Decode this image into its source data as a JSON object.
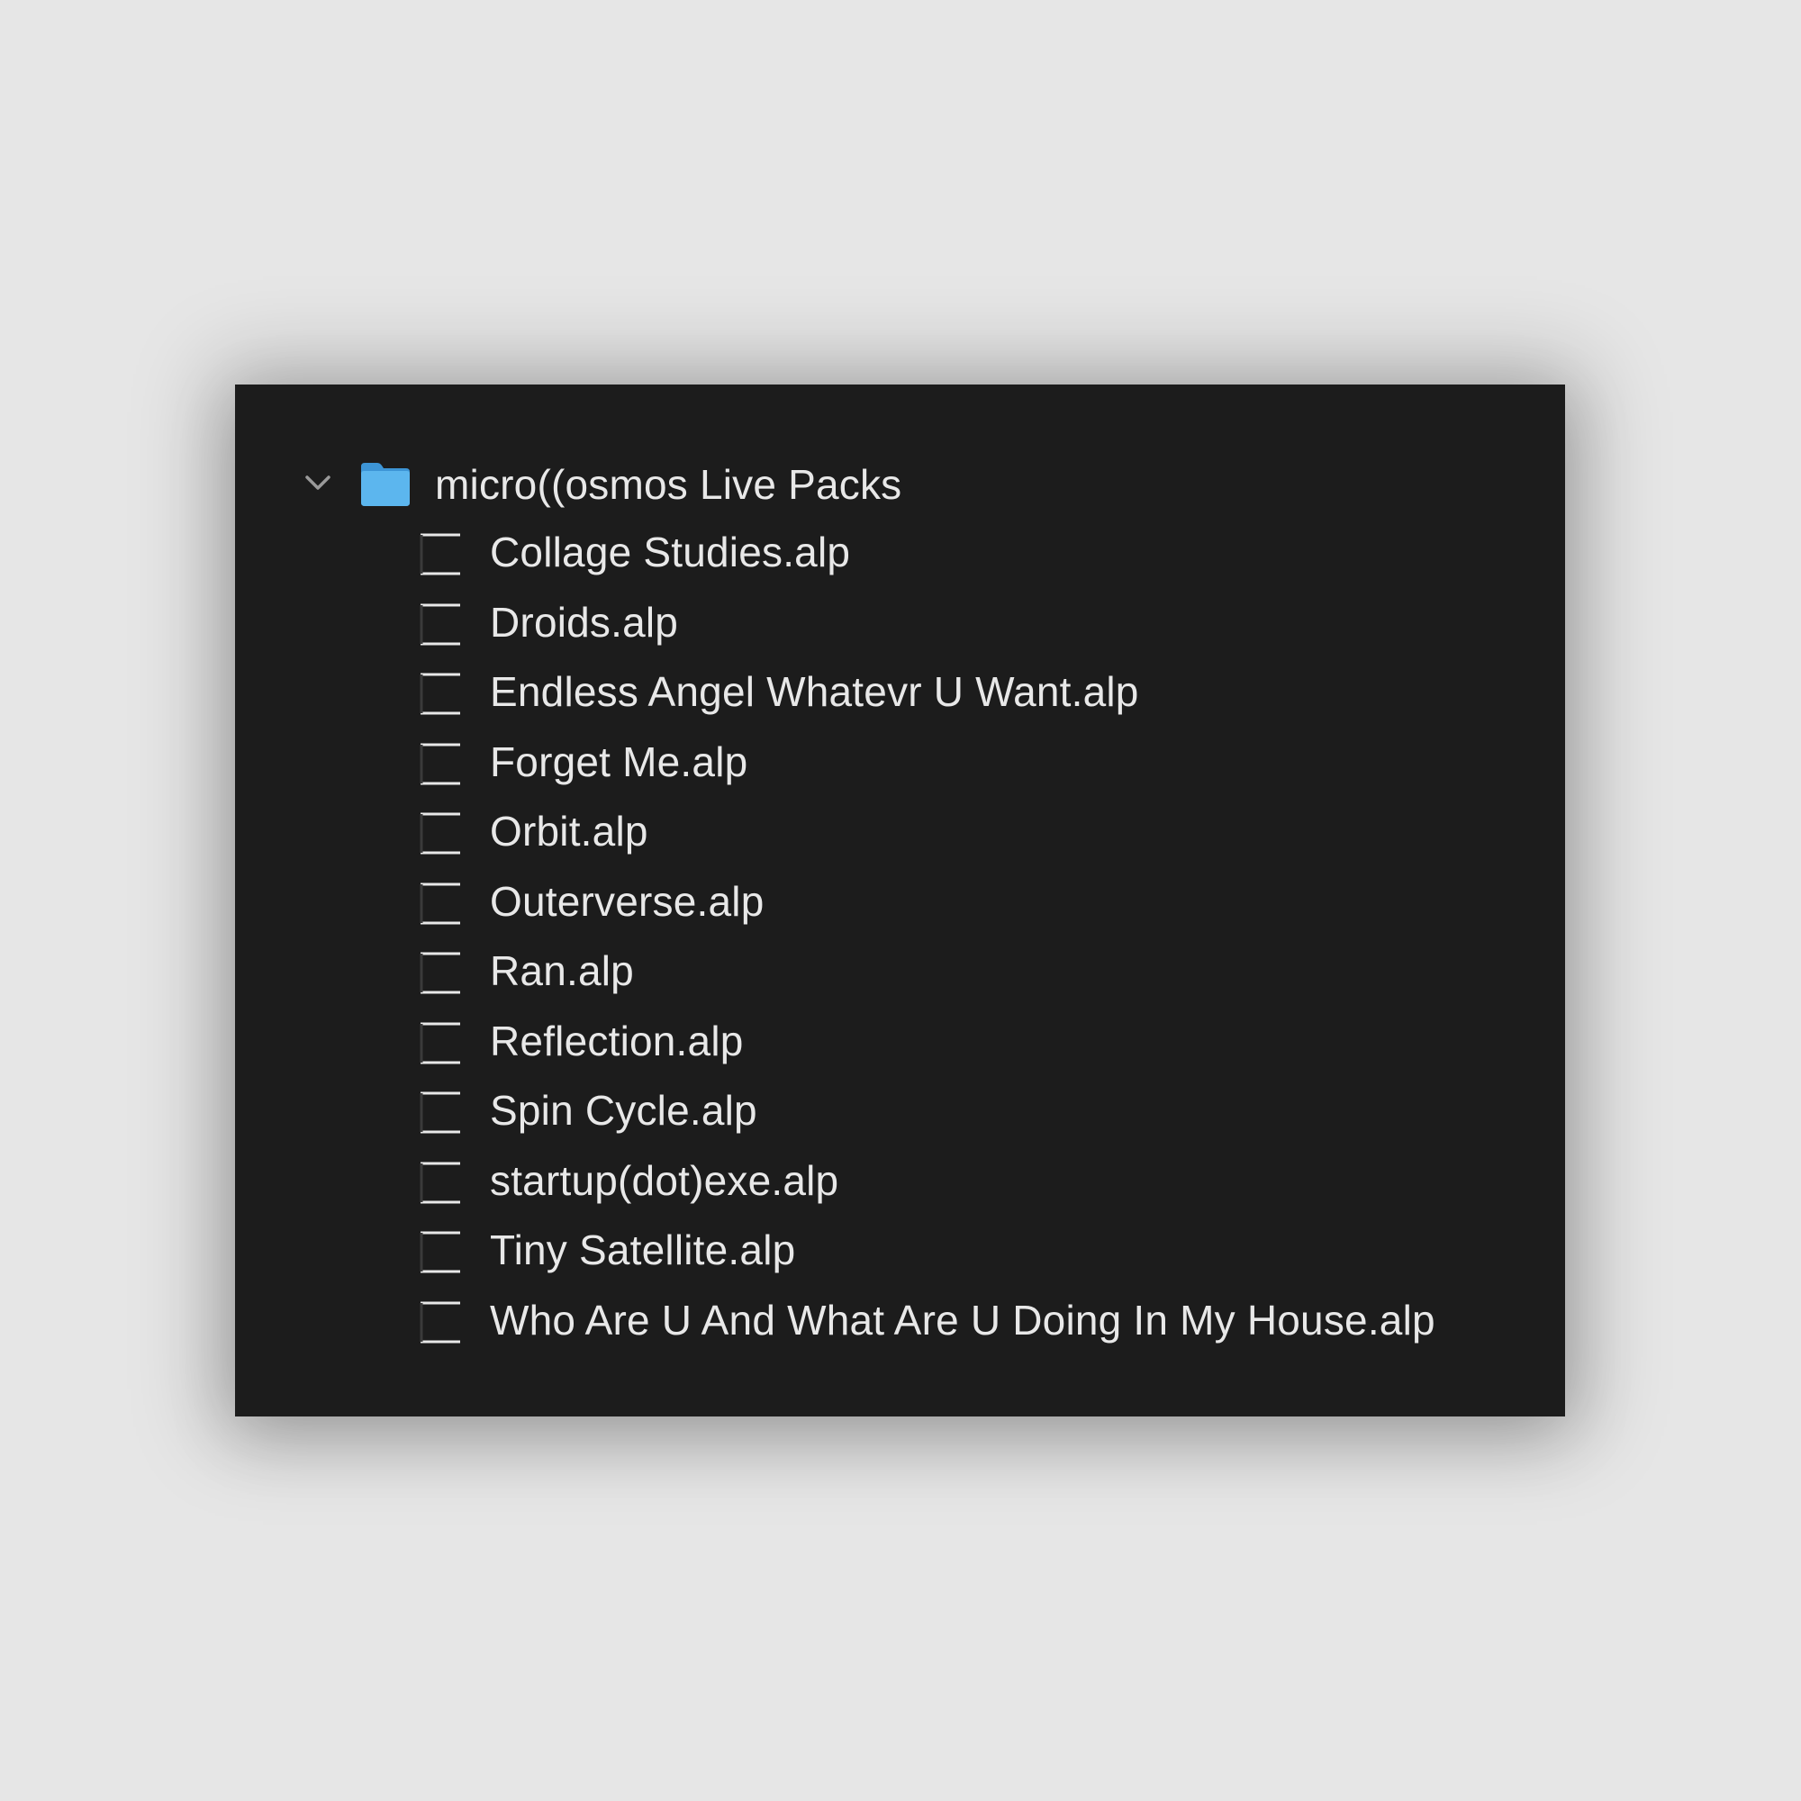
{
  "folder": {
    "name": "micro((osmos Live Packs",
    "expanded": true,
    "icon": "folder-icon",
    "icon_color": "#4aa8e6"
  },
  "files": [
    {
      "name": "Collage Studies.alp",
      "icon": "document-icon"
    },
    {
      "name": "Droids.alp",
      "icon": "document-icon"
    },
    {
      "name": "Endless Angel Whatevr U Want.alp",
      "icon": "document-icon"
    },
    {
      "name": "Forget Me.alp",
      "icon": "document-icon"
    },
    {
      "name": "Orbit.alp",
      "icon": "document-icon"
    },
    {
      "name": "Outerverse.alp",
      "icon": "document-icon"
    },
    {
      "name": "Ran.alp",
      "icon": "document-icon"
    },
    {
      "name": "Reflection.alp",
      "icon": "document-icon"
    },
    {
      "name": "Spin Cycle.alp",
      "icon": "document-icon"
    },
    {
      "name": "startup(dot)exe.alp",
      "icon": "document-icon"
    },
    {
      "name": "Tiny Satellite.alp",
      "icon": "document-icon"
    },
    {
      "name": "Who Are U And What Are U Doing In My House.alp",
      "icon": "document-icon"
    }
  ],
  "colors": {
    "page_background": "#e6e6e6",
    "panel_background": "#1c1c1c",
    "text": "#e8e8e8",
    "chevron": "#9a9a9a"
  }
}
